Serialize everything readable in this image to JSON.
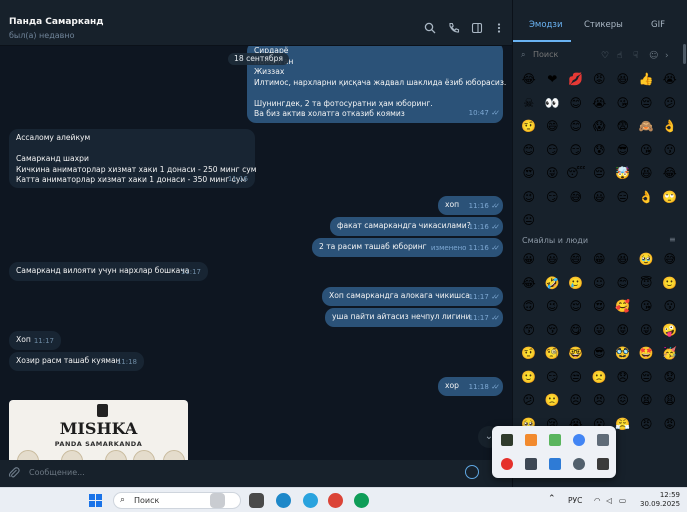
{
  "header": {
    "chat_name": "Панда Самарканд",
    "status": "был(а) недавно",
    "icons": [
      "search-icon",
      "phone-icon",
      "sidebar-icon",
      "more-icon"
    ]
  },
  "chat": {
    "date_label": "18 сентября",
    "messages": [
      {
        "side": "out",
        "lines": [
          "Сирдарё",
          "Наманган",
          "Жиззах",
          "Илтимос, нархларни қисқача жадвал шаклида ёзиб юборасиз.",
          "",
          "Шунингдек, 2 та фотосуратни ҳам юборинг.",
          "Ва биз актив холатга отказиб коямиз"
        ],
        "time": "10:47"
      },
      {
        "side": "in",
        "lines": [
          "Ассалому алейкум",
          "",
          "Самарканд шахри",
          "Кичкина аниматорлар хизмат хаки 1 донаси - 250 минг сум",
          "Катта аниматорлар хизмат хаки 1 донаси - 350 минг сум"
        ],
        "time": "11:16"
      },
      {
        "side": "out",
        "lines": [
          "хоп"
        ],
        "time": "11:16"
      },
      {
        "side": "out",
        "lines": [
          "факат самаркандга чикасилами?"
        ],
        "time": "11:16"
      },
      {
        "side": "out",
        "lines": [
          "2 та расим ташаб юборинг"
        ],
        "time": "изменено 11:16"
      },
      {
        "side": "in",
        "lines": [
          "Самарканд вилояти учун нархлар бошкача"
        ],
        "time": "11:17"
      },
      {
        "side": "out",
        "lines": [
          "Хоп самаркандга алокага чикишса"
        ],
        "time": "11:17"
      },
      {
        "side": "out",
        "lines": [
          "уша пайти айтасиз нечпул лигини"
        ],
        "time": "11:17"
      },
      {
        "side": "in",
        "lines": [
          "Хоп"
        ],
        "time": "11:17"
      },
      {
        "side": "in",
        "lines": [
          "Хозир расм ташаб куяман"
        ],
        "time": "11:18"
      },
      {
        "side": "out",
        "lines": [
          "хор"
        ],
        "time": "11:18"
      }
    ],
    "image": {
      "title": "MISHKA",
      "subtitle": "PANDA SAMARKANDA"
    }
  },
  "composer": {
    "placeholder": "Сообщение..."
  },
  "panel": {
    "tabs": [
      "Эмодзи",
      "Стикеры",
      "GIF"
    ],
    "search_placeholder": "Поиск",
    "recent_emojis": [
      "😂",
      "❤",
      "💋",
      "😡",
      "😆",
      "👍",
      "😭",
      "☠",
      "👀",
      "😊",
      "😭",
      "😘",
      "😔",
      "😕",
      "🤨",
      "😄",
      "😊",
      "😱",
      "😨",
      "🙈",
      "👌",
      "😊",
      "😏",
      "😏",
      "😰",
      "😎",
      "😘",
      "😗",
      "😍",
      "😜",
      "😴",
      "😔",
      "🤯",
      "😆",
      "😂",
      "😉",
      "😏",
      "😅",
      "😃",
      "😑",
      "👌",
      "🙄",
      "😐"
    ],
    "section_title": "Смайлы и люди",
    "smileys": [
      "😀",
      "😃",
      "😄",
      "😁",
      "😆",
      "🥹",
      "😅",
      "😂",
      "🤣",
      "🥲",
      "☺",
      "😊",
      "😇",
      "🙂",
      "🙃",
      "😉",
      "😌",
      "😍",
      "🥰",
      "😘",
      "😗",
      "😙",
      "😚",
      "😋",
      "😛",
      "😝",
      "😜",
      "🤪",
      "🤨",
      "🧐",
      "🤓",
      "😎",
      "🥸",
      "🤩",
      "🥳",
      "🙂",
      "😏",
      "😒",
      "🙁",
      "😞",
      "😔",
      "😟",
      "😕",
      "🙁",
      "☹",
      "😣",
      "😖",
      "😫",
      "😩",
      "🥺",
      "😢",
      "😭",
      "😮",
      "😤",
      "😠",
      "😡",
      "🤬"
    ]
  },
  "taskbar": {
    "search_label": "Поиск",
    "language": "РУС",
    "time": "12:59",
    "date": "30.09.2025"
  },
  "colors": {
    "chat_bg": "#0e1621",
    "incoming": "#182533",
    "outgoing": "#2b5278",
    "accent": "#6ab3f3"
  }
}
